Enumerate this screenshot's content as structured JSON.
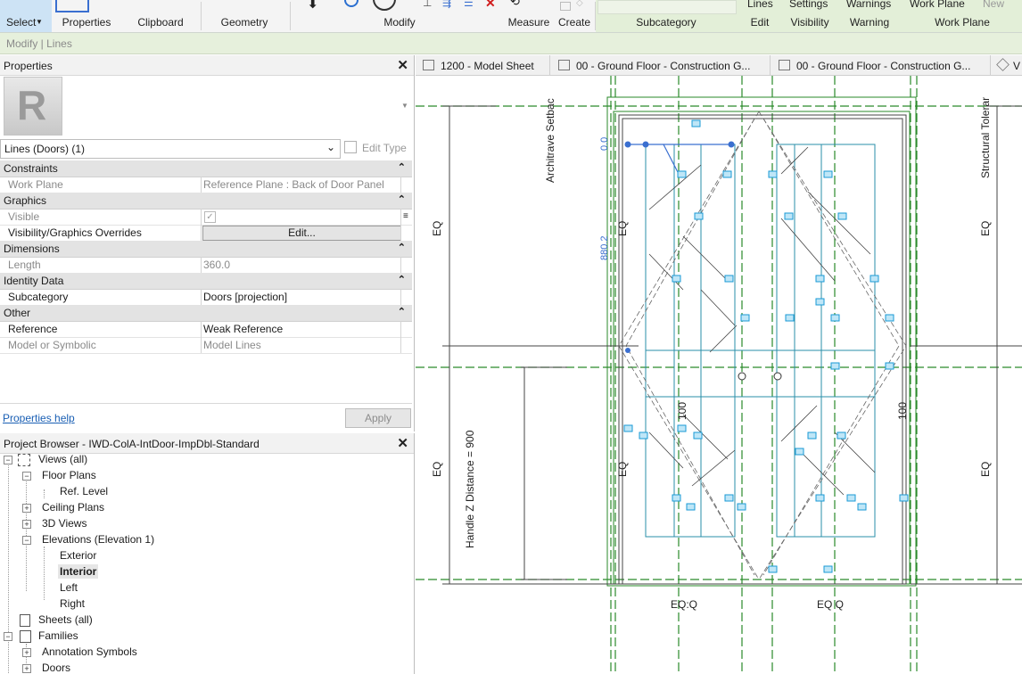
{
  "ribbon": {
    "select_label": "Select",
    "properties_label": "Properties",
    "clipboard_label": "Clipboard",
    "geometry_label": "Geometry",
    "modify_label": "Modify",
    "measure_label": "Measure",
    "create_label": "Create",
    "subcategory_label": "Subcategory",
    "edit_label": "Edit",
    "visibility_label": "Visibility",
    "warning_label": "Warning",
    "work_plane_label": "Work Plane",
    "lines_top": "Lines",
    "settings_top": "Settings",
    "warnings_top": "Warnings",
    "work_plane_top": "Work Plane",
    "new_top": "New"
  },
  "context_bar": "Modify | Lines",
  "properties": {
    "title": "Properties",
    "type_selector": "Lines (Doors) (1)",
    "edit_type": "Edit Type",
    "sections": [
      {
        "name": "Constraints",
        "rows": [
          {
            "key": "Work Plane",
            "value": "Reference Plane : Back of Door Panel"
          }
        ]
      },
      {
        "name": "Graphics",
        "rows": [
          {
            "key": "Visible",
            "value": ""
          },
          {
            "key": "Visibility/Graphics Overrides",
            "value": "Edit..."
          }
        ]
      },
      {
        "name": "Dimensions",
        "rows": [
          {
            "key": "Length",
            "value": "360.0"
          }
        ]
      },
      {
        "name": "Identity Data",
        "rows": [
          {
            "key": "Subcategory",
            "value": "Doors [projection]"
          }
        ]
      },
      {
        "name": "Other",
        "rows": [
          {
            "key": "Reference",
            "value": "Weak Reference"
          },
          {
            "key": "Model or Symbolic",
            "value": "Model Lines"
          }
        ]
      }
    ],
    "help_link": "Properties help",
    "apply_label": "Apply"
  },
  "browser": {
    "title": "Project Browser - IWD-ColA-IntDoor-ImpDbl-Standard",
    "nodes": [
      {
        "label": "Views (all)",
        "toggle": "−"
      },
      {
        "label": "Floor Plans",
        "toggle": "−"
      },
      {
        "label": "Ref. Level",
        "toggle": ""
      },
      {
        "label": "Ceiling Plans",
        "toggle": "+"
      },
      {
        "label": "3D Views",
        "toggle": "+"
      },
      {
        "label": "Elevations (Elevation 1)",
        "toggle": "−"
      },
      {
        "label": "Exterior",
        "toggle": ""
      },
      {
        "label": "Interior",
        "toggle": ""
      },
      {
        "label": "Left",
        "toggle": ""
      },
      {
        "label": "Right",
        "toggle": ""
      },
      {
        "label": "Sheets (all)",
        "toggle": ""
      },
      {
        "label": "Families",
        "toggle": "−"
      },
      {
        "label": "Annotation Symbols",
        "toggle": "+"
      },
      {
        "label": "Doors",
        "toggle": "+"
      }
    ]
  },
  "tabs": [
    {
      "label": "1200 - Model Sheet"
    },
    {
      "label": "00 - Ground Floor - Construction G..."
    },
    {
      "label": "00 - Ground Floor - Construction G..."
    },
    {
      "label": "V"
    }
  ],
  "drawing": {
    "architrave_label": "Architrave Setbac",
    "structural_label": "Structural Tolerar",
    "handle_label": "Handle Z Distance = 900",
    "eq": "EQ",
    "dim_00": "0.0",
    "dim_880": "880.2",
    "dim_100": "100",
    "eq_bottom": "EQ:Q",
    "eq_bottom2": "EQ Q"
  },
  "colors": {
    "ref_plane": "#2a8a2a",
    "lock": "#1a9ad6",
    "selected": "#3a6fd0",
    "ribbon_context": "#e3efd8"
  }
}
